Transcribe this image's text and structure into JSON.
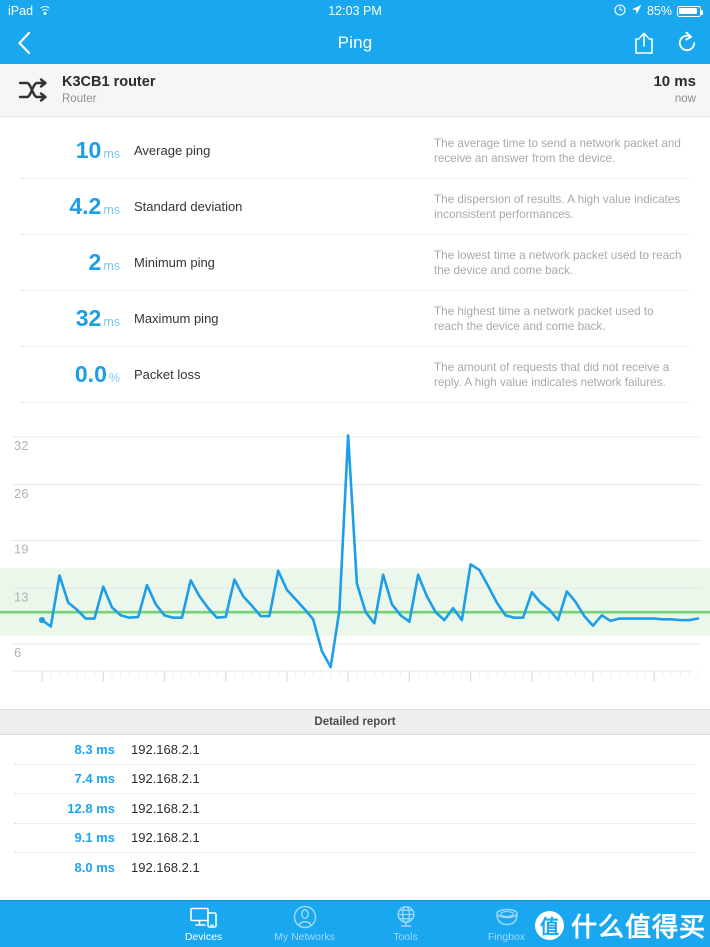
{
  "statusbar": {
    "carrier": "iPad",
    "wifi_icon": "wifi-icon",
    "time": "12:03 PM",
    "alarm_icon": "alarm-clock-icon",
    "location_icon": "location-arrow-icon",
    "battery_percent": "85%",
    "battery_level": 85
  },
  "navbar": {
    "back_icon": "chevron-left-icon",
    "title": "Ping",
    "share_icon": "share-icon",
    "refresh_icon": "refresh-icon"
  },
  "device_header": {
    "icon": "shuffle-icon",
    "name": "K3CB1 router",
    "type": "Router",
    "value": "10 ms",
    "when": "now"
  },
  "stats": [
    {
      "value": "10",
      "unit": "ms",
      "label": "Average ping",
      "description": "The average time to send a network packet and receive an answer from the device."
    },
    {
      "value": "4.2",
      "unit": "ms",
      "label": "Standard deviation",
      "description": "The dispersion of results. A high value indicates inconsistent performances."
    },
    {
      "value": "2",
      "unit": "ms",
      "label": "Minimum ping",
      "description": "The lowest time a network packet used to reach the device and come back."
    },
    {
      "value": "32",
      "unit": "ms",
      "label": "Maximum ping",
      "description": "The highest time a network packet used to reach the device and come back."
    },
    {
      "value": "0.0",
      "unit": "%",
      "label": "Packet loss",
      "description": "The amount of requests that did not receive a reply. A high value indicates network failures."
    }
  ],
  "chart_data": {
    "type": "line",
    "title": "",
    "xlabel": "",
    "ylabel": "",
    "ylim": [
      2,
      35
    ],
    "yticks": [
      6,
      13,
      19,
      26,
      32
    ],
    "ytick_labels": [
      "6",
      "13",
      "19",
      "26",
      "32"
    ],
    "grid": true,
    "legend": false,
    "line_color": "#1e9ee8",
    "band_color": "#eaf7ea",
    "average_line_color": "#74d277",
    "average_value": 10,
    "band_low": 7,
    "band_high": 15.5,
    "x": [
      1,
      2,
      3,
      4,
      5,
      6,
      7,
      8,
      9,
      10,
      11,
      12,
      13,
      14,
      15,
      16,
      17,
      18,
      19,
      20,
      21,
      22,
      23,
      24,
      25,
      26,
      27,
      28,
      29,
      30,
      31,
      32,
      33,
      34,
      35,
      36,
      37,
      38,
      39,
      40,
      41,
      42,
      43,
      44,
      45,
      46,
      47,
      48,
      49,
      50,
      51,
      52,
      53,
      54,
      55,
      56,
      57,
      58,
      59,
      60,
      61,
      62,
      63,
      64,
      65,
      66,
      67,
      68,
      69,
      70,
      71,
      72,
      73,
      74,
      75,
      76
    ],
    "values": [
      9.0,
      8.2,
      14.6,
      11.2,
      10.3,
      9.2,
      9.2,
      13.2,
      10.6,
      9.6,
      9.3,
      9.4,
      13.4,
      11.0,
      9.6,
      9.3,
      9.3,
      14.0,
      12.0,
      10.5,
      9.3,
      9.4,
      14.1,
      12.0,
      10.8,
      9.5,
      9.5,
      15.2,
      12.8,
      11.6,
      10.4,
      9.1,
      5.1,
      3.1,
      10.2,
      32.2,
      13.6,
      10.0,
      8.6,
      14.7,
      11.0,
      9.6,
      8.8,
      14.7,
      12.0,
      10.0,
      9.0,
      10.5,
      9.0,
      16.0,
      15.3,
      13.3,
      11.2,
      9.6,
      9.3,
      9.3,
      12.5,
      11.2,
      10.3,
      9.0,
      12.6,
      11.3,
      9.5,
      8.3,
      9.6,
      8.9,
      9.2,
      9.2,
      9.2,
      9.2,
      9.2,
      9.1,
      9.1,
      9.0,
      9.0,
      9.2
    ],
    "xtick_major_every": 7
  },
  "report": {
    "title": "Detailed report",
    "columns": [
      "time",
      "address"
    ],
    "rows": [
      {
        "time": "8.3 ms",
        "address": "192.168.2.1"
      },
      {
        "time": "7.4 ms",
        "address": "192.168.2.1"
      },
      {
        "time": "12.8 ms",
        "address": "192.168.2.1"
      },
      {
        "time": "9.1 ms",
        "address": "192.168.2.1"
      },
      {
        "time": "8.0 ms",
        "address": "192.168.2.1"
      }
    ]
  },
  "tabbar": {
    "items": [
      {
        "label": "Devices",
        "icon": "devices-icon",
        "active": true
      },
      {
        "label": "My Networks",
        "icon": "person-circle-icon",
        "active": false
      },
      {
        "label": "Tools",
        "icon": "globe-icon",
        "active": false
      },
      {
        "label": "Fingbox",
        "icon": "fingbox-icon",
        "active": false
      }
    ]
  },
  "watermark": {
    "badge": "值",
    "text": "什么值得买"
  },
  "colors": {
    "accent": "#19a7f0",
    "value_blue": "#1e9ee8",
    "green": "#74d277",
    "band": "#eaf7ea"
  }
}
